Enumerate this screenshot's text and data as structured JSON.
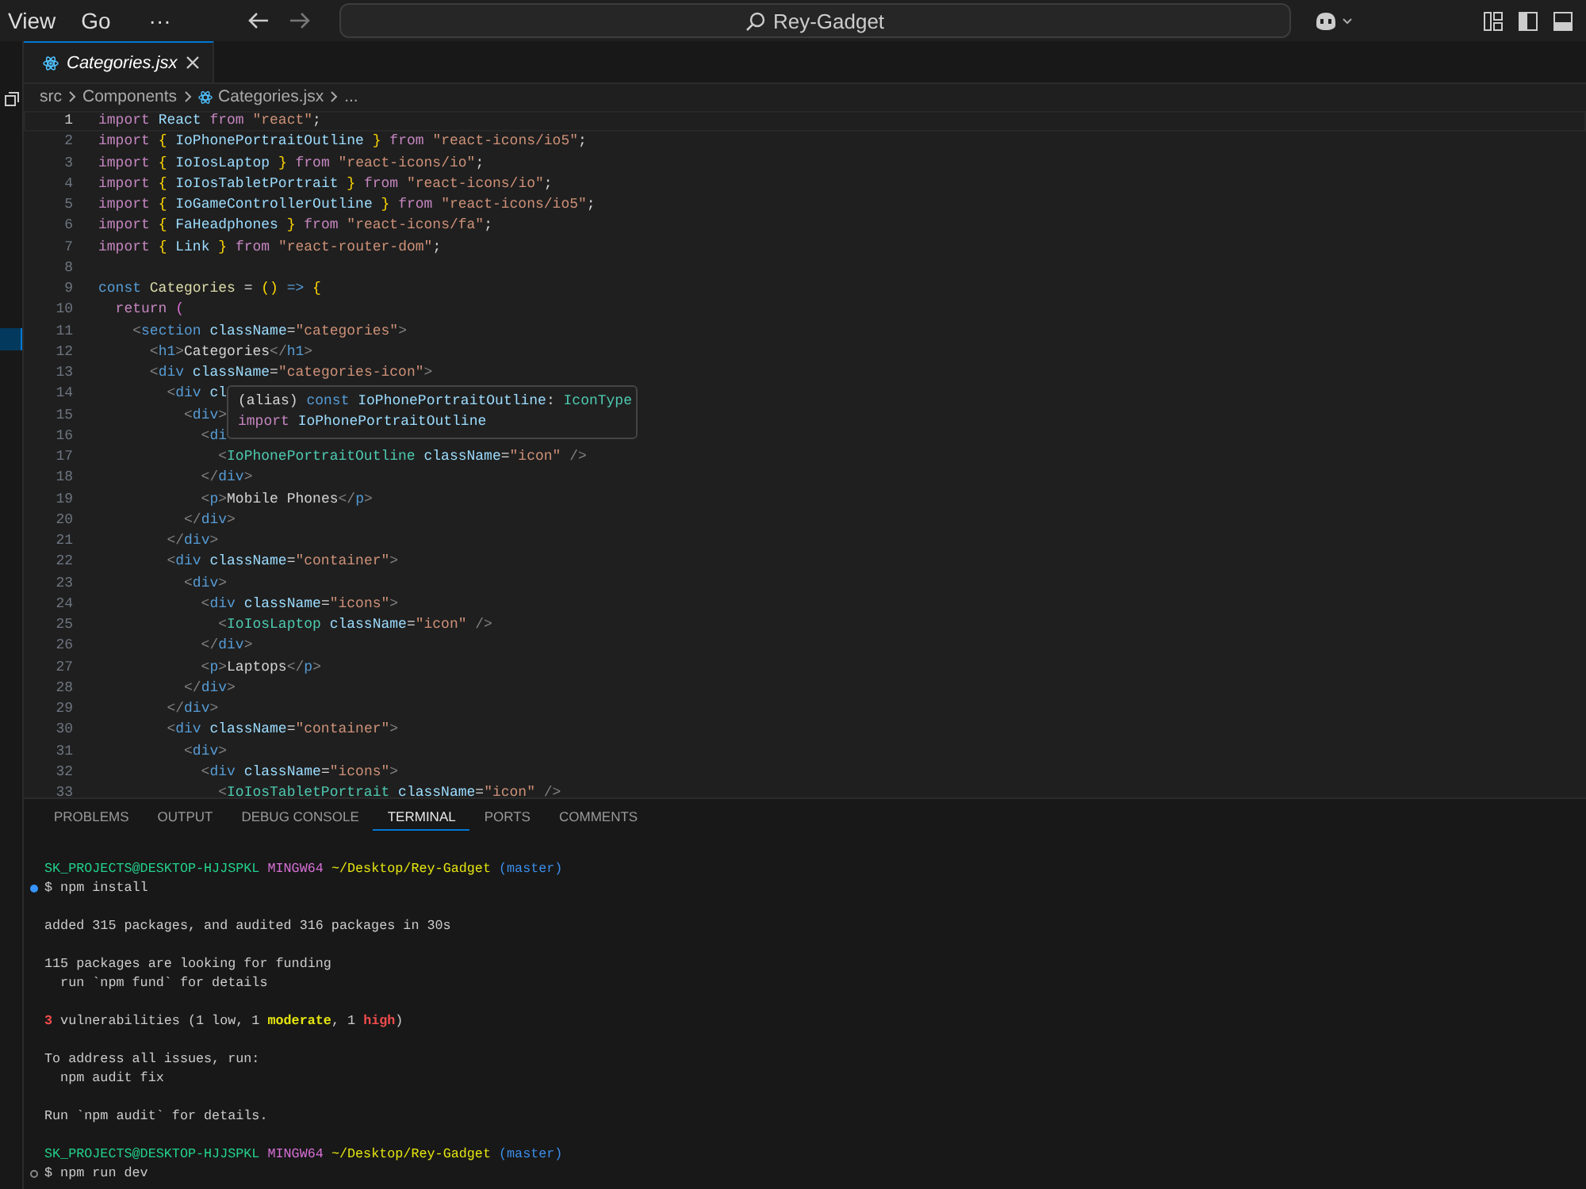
{
  "menu": [
    {
      "label": "View"
    },
    {
      "label": "Go"
    },
    {
      "label": "···"
    }
  ],
  "search": {
    "value": "Rey-Gadget"
  },
  "tabs": [
    {
      "label": "Categories.jsx",
      "selected": true,
      "preview": true
    }
  ],
  "breadcrumb": [
    "src",
    "Components",
    "Categories.jsx",
    "..."
  ],
  "code_lines": [
    {
      "no": "1",
      "current": true,
      "tokens": [
        {
          "kind": "kw",
          "t": "import "
        },
        {
          "kind": "var",
          "t": "React "
        },
        {
          "kind": "kw",
          "t": "from "
        },
        {
          "kind": "str",
          "t": "\"react\""
        },
        {
          "kind": "p",
          "t": ";"
        }
      ]
    },
    {
      "no": "2",
      "current": false,
      "tokens": [
        {
          "kind": "kw",
          "t": "import "
        },
        {
          "kind": "br",
          "t": "{ "
        },
        {
          "kind": "var",
          "t": "IoPhonePortraitOutline "
        },
        {
          "kind": "br",
          "t": "} "
        },
        {
          "kind": "kw",
          "t": "from "
        },
        {
          "kind": "str",
          "t": "\"react-icons/io5\""
        },
        {
          "kind": "p",
          "t": ";"
        }
      ]
    },
    {
      "no": "3",
      "current": false,
      "tokens": [
        {
          "kind": "kw",
          "t": "import "
        },
        {
          "kind": "br",
          "t": "{ "
        },
        {
          "kind": "var",
          "t": "IoIosLaptop "
        },
        {
          "kind": "br",
          "t": "} "
        },
        {
          "kind": "kw",
          "t": "from "
        },
        {
          "kind": "str",
          "t": "\"react-icons/io\""
        },
        {
          "kind": "p",
          "t": ";"
        }
      ]
    },
    {
      "no": "4",
      "current": false,
      "tokens": [
        {
          "kind": "kw",
          "t": "import "
        },
        {
          "kind": "br",
          "t": "{ "
        },
        {
          "kind": "var",
          "t": "IoIosTabletPortrait "
        },
        {
          "kind": "br",
          "t": "} "
        },
        {
          "kind": "kw",
          "t": "from "
        },
        {
          "kind": "str",
          "t": "\"react-icons/io\""
        },
        {
          "kind": "p",
          "t": ";"
        }
      ]
    },
    {
      "no": "5",
      "current": false,
      "tokens": [
        {
          "kind": "kw",
          "t": "import "
        },
        {
          "kind": "br",
          "t": "{ "
        },
        {
          "kind": "var",
          "t": "IoGameControllerOutline "
        },
        {
          "kind": "br",
          "t": "} "
        },
        {
          "kind": "kw",
          "t": "from "
        },
        {
          "kind": "str",
          "t": "\"react-icons/io5\""
        },
        {
          "kind": "p",
          "t": ";"
        }
      ]
    },
    {
      "no": "6",
      "current": false,
      "tokens": [
        {
          "kind": "kw",
          "t": "import "
        },
        {
          "kind": "br",
          "t": "{ "
        },
        {
          "kind": "var",
          "t": "FaHeadphones "
        },
        {
          "kind": "br",
          "t": "} "
        },
        {
          "kind": "kw",
          "t": "from "
        },
        {
          "kind": "str",
          "t": "\"react-icons/fa\""
        },
        {
          "kind": "p",
          "t": ";"
        }
      ]
    },
    {
      "no": "7",
      "current": false,
      "tokens": [
        {
          "kind": "kw",
          "t": "import "
        },
        {
          "kind": "br",
          "t": "{ "
        },
        {
          "kind": "var",
          "t": "Link "
        },
        {
          "kind": "br",
          "t": "} "
        },
        {
          "kind": "kw",
          "t": "from "
        },
        {
          "kind": "str",
          "t": "\"react-router-dom\""
        },
        {
          "kind": "p",
          "t": ";"
        }
      ]
    },
    {
      "no": "8",
      "current": false
    },
    {
      "no": "9",
      "current": false,
      "tokens": [
        {
          "kind": "decl",
          "t": "const "
        },
        {
          "kind": "fn",
          "t": "Categories "
        },
        {
          "kind": "p",
          "t": "= "
        },
        {
          "kind": "br",
          "t": "() "
        },
        {
          "kind": "decl",
          "t": "=> "
        },
        {
          "kind": "br",
          "t": "{"
        }
      ]
    },
    {
      "no": "10",
      "current": false,
      "tokens": [
        {
          "kind": "kw",
          "t": "  return "
        },
        {
          "kind": "paren",
          "t": "("
        }
      ]
    },
    {
      "no": "11",
      "current": false,
      "tokens": [
        {
          "kind": "tb",
          "t": "    <"
        },
        {
          "kind": "tag",
          "t": "section "
        },
        {
          "kind": "attr",
          "t": "className"
        },
        {
          "kind": "p",
          "t": "="
        },
        {
          "kind": "str",
          "t": "\"categories\""
        },
        {
          "kind": "tb",
          "t": ">"
        }
      ]
    },
    {
      "no": "12",
      "current": false,
      "tokens": [
        {
          "kind": "tb",
          "t": "      <"
        },
        {
          "kind": "tag",
          "t": "h1"
        },
        {
          "kind": "tb",
          "t": ">"
        },
        {
          "kind": "p",
          "t": "Categories"
        },
        {
          "kind": "tb",
          "t": "</"
        },
        {
          "kind": "tag",
          "t": "h1"
        },
        {
          "kind": "tb",
          "t": ">"
        }
      ]
    },
    {
      "no": "13",
      "current": false,
      "tokens": [
        {
          "kind": "tb",
          "t": "      <"
        },
        {
          "kind": "tag",
          "t": "div "
        },
        {
          "kind": "attr",
          "t": "className"
        },
        {
          "kind": "p",
          "t": "="
        },
        {
          "kind": "str",
          "t": "\"categories-icon\""
        },
        {
          "kind": "tb",
          "t": ">"
        }
      ]
    },
    {
      "no": "14",
      "current": false,
      "tokens": [
        {
          "kind": "tb",
          "t": "        <"
        },
        {
          "kind": "tag",
          "t": "div "
        },
        {
          "kind": "attr",
          "t": "cl"
        }
      ]
    },
    {
      "no": "15",
      "current": false,
      "tokens": [
        {
          "kind": "tb",
          "t": "          <"
        },
        {
          "kind": "tag",
          "t": "div"
        },
        {
          "kind": "tb",
          "t": ">"
        }
      ]
    },
    {
      "no": "16",
      "current": false,
      "tokens": [
        {
          "kind": "tb",
          "t": "            <"
        },
        {
          "kind": "tag",
          "t": "di"
        }
      ]
    },
    {
      "no": "17",
      "current": false,
      "tokens": [
        {
          "kind": "tb",
          "t": "              <"
        },
        {
          "kind": "comp",
          "t": "IoPhonePortraitOutline "
        },
        {
          "kind": "attr",
          "t": "className"
        },
        {
          "kind": "p",
          "t": "="
        },
        {
          "kind": "str",
          "t": "\"icon\""
        },
        {
          "kind": "tb",
          "t": " />"
        }
      ]
    },
    {
      "no": "18",
      "current": false,
      "tokens": [
        {
          "kind": "tb",
          "t": "            </"
        },
        {
          "kind": "tag",
          "t": "div"
        },
        {
          "kind": "tb",
          "t": ">"
        }
      ]
    },
    {
      "no": "19",
      "current": false,
      "tokens": [
        {
          "kind": "tb",
          "t": "            <"
        },
        {
          "kind": "tag",
          "t": "p"
        },
        {
          "kind": "tb",
          "t": ">"
        },
        {
          "kind": "p",
          "t": "Mobile Phones"
        },
        {
          "kind": "tb",
          "t": "</"
        },
        {
          "kind": "tag",
          "t": "p"
        },
        {
          "kind": "tb",
          "t": ">"
        }
      ]
    },
    {
      "no": "20",
      "current": false,
      "tokens": [
        {
          "kind": "tb",
          "t": "          </"
        },
        {
          "kind": "tag",
          "t": "div"
        },
        {
          "kind": "tb",
          "t": ">"
        }
      ]
    },
    {
      "no": "21",
      "current": false,
      "tokens": [
        {
          "kind": "tb",
          "t": "        </"
        },
        {
          "kind": "tag",
          "t": "div"
        },
        {
          "kind": "tb",
          "t": ">"
        }
      ]
    },
    {
      "no": "22",
      "current": false,
      "tokens": [
        {
          "kind": "tb",
          "t": "        <"
        },
        {
          "kind": "tag",
          "t": "div "
        },
        {
          "kind": "attr",
          "t": "className"
        },
        {
          "kind": "p",
          "t": "="
        },
        {
          "kind": "str",
          "t": "\"container\""
        },
        {
          "kind": "tb",
          "t": ">"
        }
      ]
    },
    {
      "no": "23",
      "current": false,
      "tokens": [
        {
          "kind": "tb",
          "t": "          <"
        },
        {
          "kind": "tag",
          "t": "div"
        },
        {
          "kind": "tb",
          "t": ">"
        }
      ]
    },
    {
      "no": "24",
      "current": false,
      "tokens": [
        {
          "kind": "tb",
          "t": "            <"
        },
        {
          "kind": "tag",
          "t": "div "
        },
        {
          "kind": "attr",
          "t": "className"
        },
        {
          "kind": "p",
          "t": "="
        },
        {
          "kind": "str",
          "t": "\"icons\""
        },
        {
          "kind": "tb",
          "t": ">"
        }
      ]
    },
    {
      "no": "25",
      "current": false,
      "tokens": [
        {
          "kind": "tb",
          "t": "              <"
        },
        {
          "kind": "comp",
          "t": "IoIosLaptop "
        },
        {
          "kind": "attr",
          "t": "className"
        },
        {
          "kind": "p",
          "t": "="
        },
        {
          "kind": "str",
          "t": "\"icon\""
        },
        {
          "kind": "tb",
          "t": " />"
        }
      ]
    },
    {
      "no": "26",
      "current": false,
      "tokens": [
        {
          "kind": "tb",
          "t": "            </"
        },
        {
          "kind": "tag",
          "t": "div"
        },
        {
          "kind": "tb",
          "t": ">"
        }
      ]
    },
    {
      "no": "27",
      "current": false,
      "tokens": [
        {
          "kind": "tb",
          "t": "            <"
        },
        {
          "kind": "tag",
          "t": "p"
        },
        {
          "kind": "tb",
          "t": ">"
        },
        {
          "kind": "p",
          "t": "Laptops"
        },
        {
          "kind": "tb",
          "t": "</"
        },
        {
          "kind": "tag",
          "t": "p"
        },
        {
          "kind": "tb",
          "t": ">"
        }
      ]
    },
    {
      "no": "28",
      "current": false,
      "tokens": [
        {
          "kind": "tb",
          "t": "          </"
        },
        {
          "kind": "tag",
          "t": "div"
        },
        {
          "kind": "tb",
          "t": ">"
        }
      ]
    },
    {
      "no": "29",
      "current": false,
      "tokens": [
        {
          "kind": "tb",
          "t": "        </"
        },
        {
          "kind": "tag",
          "t": "div"
        },
        {
          "kind": "tb",
          "t": ">"
        }
      ]
    },
    {
      "no": "30",
      "current": false,
      "tokens": [
        {
          "kind": "tb",
          "t": "        <"
        },
        {
          "kind": "tag",
          "t": "div "
        },
        {
          "kind": "attr",
          "t": "className"
        },
        {
          "kind": "p",
          "t": "="
        },
        {
          "kind": "str",
          "t": "\"container\""
        },
        {
          "kind": "tb",
          "t": ">"
        }
      ]
    },
    {
      "no": "31",
      "current": false,
      "tokens": [
        {
          "kind": "tb",
          "t": "          <"
        },
        {
          "kind": "tag",
          "t": "div"
        },
        {
          "kind": "tb",
          "t": ">"
        }
      ]
    },
    {
      "no": "32",
      "current": false,
      "tokens": [
        {
          "kind": "tb",
          "t": "            <"
        },
        {
          "kind": "tag",
          "t": "div "
        },
        {
          "kind": "attr",
          "t": "className"
        },
        {
          "kind": "p",
          "t": "="
        },
        {
          "kind": "str",
          "t": "\"icons\""
        },
        {
          "kind": "tb",
          "t": ">"
        }
      ]
    },
    {
      "no": "33",
      "current": false,
      "tokens": [
        {
          "kind": "tb",
          "t": "              <"
        },
        {
          "kind": "comp",
          "t": "IoIosTabletPortrait "
        },
        {
          "kind": "attr",
          "t": "className"
        },
        {
          "kind": "p",
          "t": "="
        },
        {
          "kind": "str",
          "t": "\"icon\""
        },
        {
          "kind": "tb",
          "t": " />"
        }
      ]
    }
  ],
  "hover_tooltip": {
    "lines": [
      [
        {
          "kind": "p",
          "t": "(alias) "
        },
        {
          "kind": "decl",
          "t": "const "
        },
        {
          "kind": "var",
          "t": "IoPhonePortraitOutline"
        },
        {
          "kind": "p",
          "t": ": "
        },
        {
          "kind": "comp",
          "t": "IconType"
        }
      ],
      [
        {
          "kind": "kw",
          "t": "import "
        },
        {
          "kind": "var",
          "t": "IoPhonePortraitOutline"
        }
      ]
    ]
  },
  "panel_tabs": [
    {
      "label": "PROBLEMS",
      "selected": false
    },
    {
      "label": "OUTPUT",
      "selected": false
    },
    {
      "label": "DEBUG CONSOLE",
      "selected": false
    },
    {
      "label": "TERMINAL",
      "selected": true
    },
    {
      "label": "PORTS",
      "selected": false
    },
    {
      "label": "COMMENTS",
      "selected": false
    }
  ],
  "terminal_blocks": [
    [
      {
        "segs": [
          {
            "kind": "user",
            "t": "SK_PROJECTS@DESKTOP-HJJSPKL "
          },
          {
            "kind": "shell",
            "t": "MINGW64 "
          },
          {
            "kind": "path",
            "t": "~/Desktop/Rey-Gadget "
          },
          {
            "kind": "branch",
            "t": "(master)"
          }
        ]
      },
      {
        "kind": "succeeded",
        "segs": [
          {
            "kind": "plain",
            "t": "$ npm install"
          }
        ]
      }
    ],
    [
      {
        "segs": [
          {
            "kind": "plain",
            "t": "added 315 packages, and audited 316 packages in 30s"
          }
        ]
      }
    ],
    [
      {
        "segs": [
          {
            "kind": "plain",
            "t": "115 packages are looking for funding"
          }
        ]
      },
      {
        "segs": [
          {
            "kind": "plain",
            "t": "  run `npm fund` for details"
          }
        ]
      }
    ],
    [
      {
        "segs": [
          {
            "kind": "danger",
            "t": "3"
          },
          {
            "kind": "plain",
            "t": " vulnerabilities (1 low, 1 "
          },
          {
            "kind": "warn",
            "t": "moderate"
          },
          {
            "kind": "plain",
            "t": ", 1 "
          },
          {
            "kind": "danger",
            "t": "high"
          },
          {
            "kind": "plain",
            "t": ")"
          }
        ]
      }
    ],
    [
      {
        "segs": [
          {
            "kind": "plain",
            "t": "To address all issues, run:"
          }
        ]
      },
      {
        "segs": [
          {
            "kind": "plain",
            "t": "  npm audit fix"
          }
        ]
      }
    ],
    [
      {
        "segs": [
          {
            "kind": "plain",
            "t": "Run `npm audit` for details."
          }
        ]
      }
    ],
    [
      {
        "segs": [
          {
            "kind": "user",
            "t": "SK_PROJECTS@DESKTOP-HJJSPKL "
          },
          {
            "kind": "shell",
            "t": "MINGW64 "
          },
          {
            "kind": "path",
            "t": "~/Desktop/Rey-Gadget "
          },
          {
            "kind": "branch",
            "t": "(master)"
          }
        ]
      },
      {
        "kind": "running",
        "segs": [
          {
            "kind": "plain",
            "t": "$ npm run dev"
          }
        ]
      }
    ]
  ]
}
